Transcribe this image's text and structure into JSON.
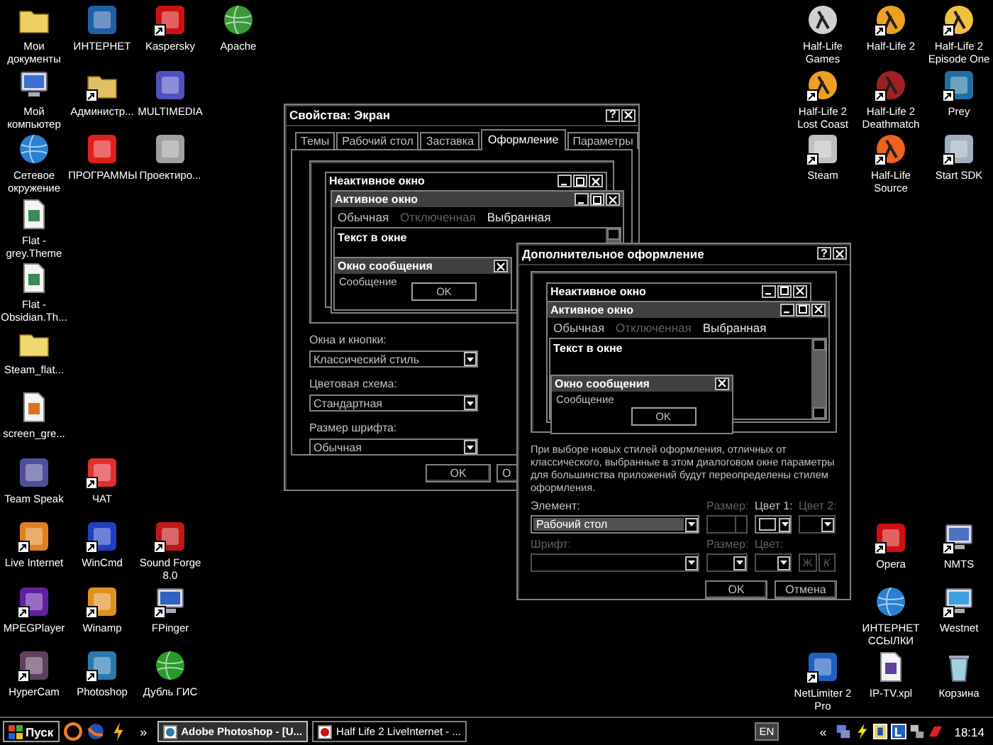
{
  "desktop": {
    "left_rows": [
      {
        "icons": [
          {
            "label": "Мои документы",
            "kind": "folder",
            "color": "#f0d060",
            "shortcut": false
          },
          {
            "label": "ИНТЕРНЕТ",
            "kind": "app",
            "color": "#1f5fa8",
            "shortcut": false
          },
          {
            "label": "Kaspersky",
            "kind": "app",
            "color": "#d01010",
            "shortcut": true
          },
          {
            "label": "Apache",
            "kind": "globe",
            "color": "#3a9a3a",
            "shortcut": false
          }
        ]
      },
      {
        "icons": [
          {
            "label": "Мой компьютер",
            "kind": "computer",
            "color": "#3a70d0",
            "shortcut": false
          },
          {
            "label": "Администр...",
            "kind": "folder",
            "color": "#e0c060",
            "shortcut": true
          },
          {
            "label": "MULTIMEDIA",
            "kind": "app",
            "color": "#5050c0",
            "shortcut": false
          }
        ]
      },
      {
        "icons": [
          {
            "label": "Сетевое окружение",
            "kind": "globe",
            "color": "#2a80d0",
            "shortcut": false
          },
          {
            "label": "ПРОГРАММЫ",
            "kind": "app",
            "color": "#e02020",
            "shortcut": false
          },
          {
            "label": "Проектиро...",
            "kind": "app",
            "color": "#a0a0a0",
            "shortcut": false
          }
        ]
      },
      {
        "icons": [
          {
            "label": "Flat - grey.Theme",
            "kind": "document",
            "color": "#3a8a5a",
            "shortcut": false
          }
        ]
      },
      {
        "icons": [
          {
            "label": "Flat - Obsidian.Th...",
            "kind": "document",
            "color": "#3a8a5a",
            "shortcut": false
          }
        ]
      },
      {
        "icons": [
          {
            "label": "Steam_flat...",
            "kind": "folder",
            "color": "#f0d870",
            "shortcut": false
          }
        ]
      },
      {
        "icons": [
          {
            "label": "screen_gre...",
            "kind": "document",
            "color": "#e07020",
            "shortcut": false
          }
        ]
      },
      {
        "icons": [
          {
            "label": "Team Speak",
            "kind": "app",
            "color": "#50509a",
            "shortcut": false
          },
          {
            "label": "ЧАТ",
            "kind": "app",
            "color": "#e03030",
            "shortcut": true
          }
        ]
      },
      {
        "icons": [
          {
            "label": "Live Internet",
            "kind": "app",
            "color": "#e08020",
            "shortcut": true
          },
          {
            "label": "WinCmd",
            "kind": "app",
            "color": "#2040c0",
            "shortcut": true
          },
          {
            "label": "Sound Forge 8.0",
            "kind": "app",
            "color": "#c01818",
            "shortcut": true
          }
        ]
      },
      {
        "icons": [
          {
            "label": "MPEGPlayer",
            "kind": "app",
            "color": "#6020a0",
            "shortcut": true
          },
          {
            "label": "Winamp",
            "kind": "app",
            "color": "#e09020",
            "shortcut": true
          },
          {
            "label": "FPinger",
            "kind": "computer",
            "color": "#3060c0",
            "shortcut": true
          }
        ]
      },
      {
        "icons": [
          {
            "label": "HyperCam",
            "kind": "app",
            "color": "#604060",
            "shortcut": true
          },
          {
            "label": "Photoshop",
            "kind": "app",
            "color": "#2a7ab0",
            "shortcut": true
          },
          {
            "label": "Дубль ГИС",
            "kind": "globe",
            "color": "#2a9a2a",
            "shortcut": false
          }
        ]
      }
    ],
    "right_top_rows": [
      {
        "icons": [
          {
            "label": "Half-Life Games",
            "kind": "halflife",
            "color": "#d0d0d0",
            "shortcut": false
          },
          {
            "label": "Half-Life 2",
            "kind": "halflife",
            "color": "#f0a020",
            "shortcut": true
          },
          {
            "label": "Half-Life 2 Episode One",
            "kind": "halflife",
            "color": "#f0c040",
            "shortcut": true
          }
        ]
      },
      {
        "icons": [
          {
            "label": "Half-Life 2 Lost Coast",
            "kind": "halflife",
            "color": "#f0a020",
            "shortcut": true
          },
          {
            "label": "Half-Life 2 Deathmatch",
            "kind": "halflife",
            "color": "#a02020",
            "shortcut": true
          },
          {
            "label": "Prey",
            "kind": "app",
            "color": "#2070a0",
            "shortcut": true
          }
        ]
      },
      {
        "icons": [
          {
            "label": "Steam",
            "kind": "app",
            "color": "#c0c0c0",
            "shortcut": true
          },
          {
            "label": "Half-Life Source",
            "kind": "halflife",
            "color": "#f06020",
            "shortcut": true
          },
          {
            "label": "Start SDK",
            "kind": "app",
            "color": "#a0b0c0",
            "shortcut": true
          }
        ]
      }
    ],
    "right_bottom_rows": [
      {
        "icons": [
          {
            "label": "Opera",
            "kind": "app",
            "color": "#d01010",
            "shortcut": true
          },
          {
            "label": "NMTS",
            "kind": "computer",
            "color": "#5070c0",
            "shortcut": true
          }
        ]
      },
      {
        "icons": [
          {
            "label": "ИНТЕРНЕТ ССЫЛКИ",
            "kind": "globe",
            "color": "#2a80d0",
            "shortcut": false
          },
          {
            "label": "Westnet",
            "kind": "computer",
            "color": "#40a0e0",
            "shortcut": true
          }
        ]
      },
      {
        "icons": [
          {
            "label": "NetLimiter 2 Pro",
            "kind": "app",
            "color": "#2060c0",
            "shortcut": true
          },
          {
            "label": "IP-TV.xpl",
            "kind": "document",
            "color": "#6040a0",
            "shortcut": false
          },
          {
            "label": "Корзина",
            "kind": "trash",
            "color": "#a0d0e0",
            "shortcut": false
          }
        ]
      }
    ]
  },
  "display_properties": {
    "title": "Свойства: Экран",
    "help": "?",
    "tabs": [
      {
        "label": "Темы",
        "selected": false
      },
      {
        "label": "Рабочий стол",
        "selected": false
      },
      {
        "label": "Заставка",
        "selected": false
      },
      {
        "label": "Оформление",
        "selected": true
      },
      {
        "label": "Параметры",
        "selected": false
      }
    ],
    "preview": {
      "inactive_title": "Неактивное окно",
      "active_title": "Активное окно",
      "menu": [
        {
          "label": "Обычная",
          "kind": "normal"
        },
        {
          "label": "Отключенная",
          "kind": "disabled"
        },
        {
          "label": "Выбранная",
          "kind": "selected"
        }
      ],
      "text": "Текст в окне",
      "message_title": "Окно сообщения",
      "message": "Сообщение",
      "ok": "OK"
    },
    "fields": [
      {
        "label": "Окна и кнопки:",
        "value": "Классический стиль"
      },
      {
        "label": "Цветовая схема:",
        "value": "Стандартная"
      },
      {
        "label": "Размер шрифта:",
        "value": "Обычная"
      }
    ],
    "buttons": [
      "OK",
      "О"
    ]
  },
  "advanced_appearance": {
    "title": "Дополнительное оформление",
    "help": "?",
    "preview": {
      "inactive_title": "Неактивное окно",
      "active_title": "Активное окно",
      "menu": [
        {
          "label": "Обычная",
          "kind": "normal"
        },
        {
          "label": "Отключенная",
          "kind": "disabled"
        },
        {
          "label": "Выбранная",
          "kind": "selected"
        }
      ],
      "text": "Текст в окне",
      "message_title": "Окно сообщения",
      "message": "Сообщение",
      "ok": "OK"
    },
    "description": "При выборе новых стилей оформления, отличных от классического, выбранные в этом диалоговом окне параметры для большинства приложений будут переопределены стилем оформления.",
    "rows": [
      {
        "fields": [
          {
            "label": "Элемент:",
            "kind": "select",
            "value": "Рабочий стол",
            "focused": true,
            "disabled": false
          },
          {
            "label": "Размер:",
            "kind": "spinner",
            "disabled": true
          },
          {
            "label": "Цвет 1:",
            "kind": "color",
            "disabled": false
          },
          {
            "label": "Цвет 2:",
            "kind": "color",
            "disabled": true
          }
        ]
      },
      {
        "fields": [
          {
            "label": "Шрифт:",
            "kind": "select",
            "disabled": true
          },
          {
            "label": "Размер:",
            "kind": "select",
            "disabled": true
          },
          {
            "label": "Цвет:",
            "kind": "color",
            "disabled": true
          },
          {
            "kind": "font_style",
            "buttons": [
              "Ж",
              "К"
            ],
            "disabled": true
          }
        ]
      }
    ],
    "buttons": [
      "OK",
      "Отмена"
    ]
  },
  "taskbar": {
    "start": "Пуск",
    "more": "»",
    "tasks": [
      {
        "label": "Adobe Photoshop - [U...",
        "selected": true
      },
      {
        "label": "Half Life 2 LiveInternet - ...",
        "selected": false
      }
    ],
    "language": "EN",
    "tray_expand": "«",
    "clock": "18:14"
  }
}
